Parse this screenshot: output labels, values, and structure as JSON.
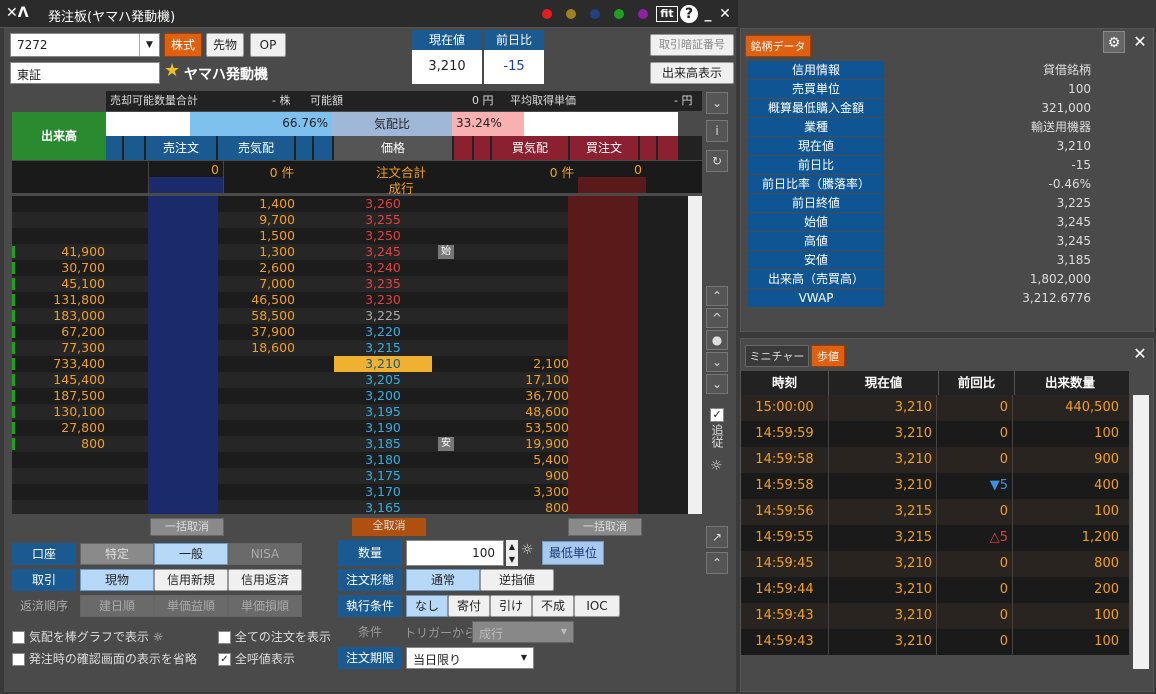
{
  "window": {
    "title": "発注板(ヤマハ発動機)",
    "logo": "✕Λ"
  },
  "top": {
    "code": "7272",
    "market": "東証",
    "tabs": [
      "株式",
      "先物",
      "OP"
    ],
    "stock_name": "ヤマハ発動機",
    "current_label": "現在値",
    "current_value": "3,210",
    "change_label": "前日比",
    "change_value": "-15",
    "pin_button": "取引暗証番号",
    "volume_button": "出来高表示"
  },
  "info_bar": {
    "sell_total_label": "売却可能数量合計",
    "sell_total_value": "- 株",
    "avail_label": "可能額",
    "avail_value": "0 円",
    "avg_label": "平均取得単価",
    "avg_value": "- 円"
  },
  "ratio": {
    "volume_label": "出来高",
    "sell_pct": "66.76%",
    "label": "気配比",
    "buy_pct": "33.24%"
  },
  "book_headers": {
    "sell_order": "売注文",
    "sell_quote": "売気配",
    "price": "価格",
    "buy_quote": "買気配",
    "buy_order": "買注文"
  },
  "summary": {
    "sell_order": "0",
    "sell_quote": "0 件",
    "price1": "注文合計",
    "price2": "成行",
    "buy_quote": "0 件",
    "buy_order": "0"
  },
  "book": [
    {
      "vol": "",
      "sq": "1,400",
      "p": "3,260",
      "pc": "#e04040",
      "bq": "",
      "tag": ""
    },
    {
      "vol": "",
      "sq": "9,700",
      "p": "3,255",
      "pc": "#e04040",
      "bq": "",
      "tag": ""
    },
    {
      "vol": "",
      "sq": "1,500",
      "p": "3,250",
      "pc": "#e04040",
      "bq": "",
      "tag": ""
    },
    {
      "vol": "41,900",
      "sq": "1,300",
      "p": "3,245",
      "pc": "#e04040",
      "bq": "",
      "tag": "始"
    },
    {
      "vol": "30,700",
      "sq": "2,600",
      "p": "3,240",
      "pc": "#e04040",
      "bq": "",
      "tag": ""
    },
    {
      "vol": "45,100",
      "sq": "7,000",
      "p": "3,235",
      "pc": "#e04040",
      "bq": "",
      "tag": ""
    },
    {
      "vol": "131,800",
      "sq": "46,500",
      "p": "3,230",
      "pc": "#e04040",
      "bq": "",
      "tag": ""
    },
    {
      "vol": "183,000",
      "sq": "58,500",
      "p": "3,225",
      "pc": "#aaaaaa",
      "bq": "",
      "tag": ""
    },
    {
      "vol": "67,200",
      "sq": "37,900",
      "p": "3,220",
      "pc": "#30b0e0",
      "bq": "",
      "tag": ""
    },
    {
      "vol": "77,300",
      "sq": "18,600",
      "p": "3,215",
      "pc": "#30b0e0",
      "bq": "",
      "tag": ""
    },
    {
      "vol": "733,400",
      "sq": "",
      "p": "3,210",
      "pc": "#1a5a90",
      "bq": "2,100",
      "tag": "",
      "cur": true
    },
    {
      "vol": "145,400",
      "sq": "",
      "p": "3,205",
      "pc": "#30b0e0",
      "bq": "17,100",
      "tag": ""
    },
    {
      "vol": "187,500",
      "sq": "",
      "p": "3,200",
      "pc": "#30b0e0",
      "bq": "36,700",
      "tag": ""
    },
    {
      "vol": "130,100",
      "sq": "",
      "p": "3,195",
      "pc": "#30b0e0",
      "bq": "48,600",
      "tag": ""
    },
    {
      "vol": "27,800",
      "sq": "",
      "p": "3,190",
      "pc": "#30b0e0",
      "bq": "53,500",
      "tag": ""
    },
    {
      "vol": "800",
      "sq": "",
      "p": "3,185",
      "pc": "#30b0e0",
      "bq": "19,900",
      "tag": "安"
    },
    {
      "vol": "",
      "sq": "",
      "p": "3,180",
      "pc": "#30b0e0",
      "bq": "5,400",
      "tag": ""
    },
    {
      "vol": "",
      "sq": "",
      "p": "3,175",
      "pc": "#30b0e0",
      "bq": "900",
      "tag": ""
    },
    {
      "vol": "",
      "sq": "",
      "p": "3,170",
      "pc": "#30b0e0",
      "bq": "3,300",
      "tag": ""
    },
    {
      "vol": "",
      "sq": "",
      "p": "3,165",
      "pc": "#30b0e0",
      "bq": "800",
      "tag": ""
    }
  ],
  "cancel": {
    "left": "一括取消",
    "center": "全取消",
    "right": "一括取消"
  },
  "form": {
    "account_label": "口座",
    "account_opts": [
      "特定",
      "一般",
      "NISA"
    ],
    "trade_label": "取引",
    "trade_opts": [
      "現物",
      "信用新規",
      "信用返済"
    ],
    "repay_label": "返済順序",
    "repay_opts": [
      "建日順",
      "単価益順",
      "単価損順"
    ],
    "qty_label": "数量",
    "qty_value": "100",
    "min_unit": "最低単位",
    "type_label": "注文形態",
    "type_opts": [
      "通常",
      "逆指値"
    ],
    "cond_label": "執行条件",
    "cond_opts": [
      "なし",
      "寄付",
      "引け",
      "不成",
      "IOC"
    ],
    "trigger_label": "条件",
    "trigger_from": "トリガーから",
    "trigger_value": "成行",
    "period_label": "注文期限",
    "period_value": "当日限り",
    "cb1": "気配を棒グラフで表示",
    "cb2": "発注時の確認画面の表示を省略",
    "cb3": "全ての注文を表示",
    "cb4": "全呼値表示",
    "follow": "追従"
  },
  "stock_data": {
    "tab": "銘柄データ",
    "rows": [
      {
        "k": "信用情報",
        "v": "貸借銘柄"
      },
      {
        "k": "売買単位",
        "v": "100"
      },
      {
        "k": "概算最低購入金額",
        "v": "321,000"
      },
      {
        "k": "業種",
        "v": "輸送用機器"
      },
      {
        "k": "現在値",
        "v": "3,210"
      },
      {
        "k": "前日比",
        "v": "-15"
      },
      {
        "k": "前日比率（騰落率）",
        "v": "-0.46%"
      },
      {
        "k": "前日終値",
        "v": "3,225"
      },
      {
        "k": "始値",
        "v": "3,245"
      },
      {
        "k": "高値",
        "v": "3,245"
      },
      {
        "k": "安値",
        "v": "3,185"
      },
      {
        "k": "出来高（売買高）",
        "v": "1,802,000"
      },
      {
        "k": "VWAP",
        "v": "3,212.6776"
      }
    ]
  },
  "ticks": {
    "tab1": "ミニチャート",
    "tab2": "歩値",
    "headers": [
      "時刻",
      "現在値",
      "前回比",
      "出来数量"
    ],
    "rows": [
      {
        "t": "15:00:00",
        "p": "3,210",
        "c": "0",
        "q": "440,500"
      },
      {
        "t": "14:59:59",
        "p": "3,210",
        "c": "0",
        "q": "100"
      },
      {
        "t": "14:59:58",
        "p": "3,210",
        "c": "0",
        "q": "900"
      },
      {
        "t": "14:59:58",
        "p": "3,210",
        "c": "▼5",
        "q": "400"
      },
      {
        "t": "14:59:56",
        "p": "3,215",
        "c": "0",
        "q": "100"
      },
      {
        "t": "14:59:55",
        "p": "3,215",
        "c": "△5",
        "q": "1,200"
      },
      {
        "t": "14:59:45",
        "p": "3,210",
        "c": "0",
        "q": "800"
      },
      {
        "t": "14:59:44",
        "p": "3,210",
        "c": "0",
        "q": "200"
      },
      {
        "t": "14:59:43",
        "p": "3,210",
        "c": "0",
        "q": "100"
      },
      {
        "t": "14:59:43",
        "p": "3,210",
        "c": "0",
        "q": "100"
      }
    ]
  }
}
